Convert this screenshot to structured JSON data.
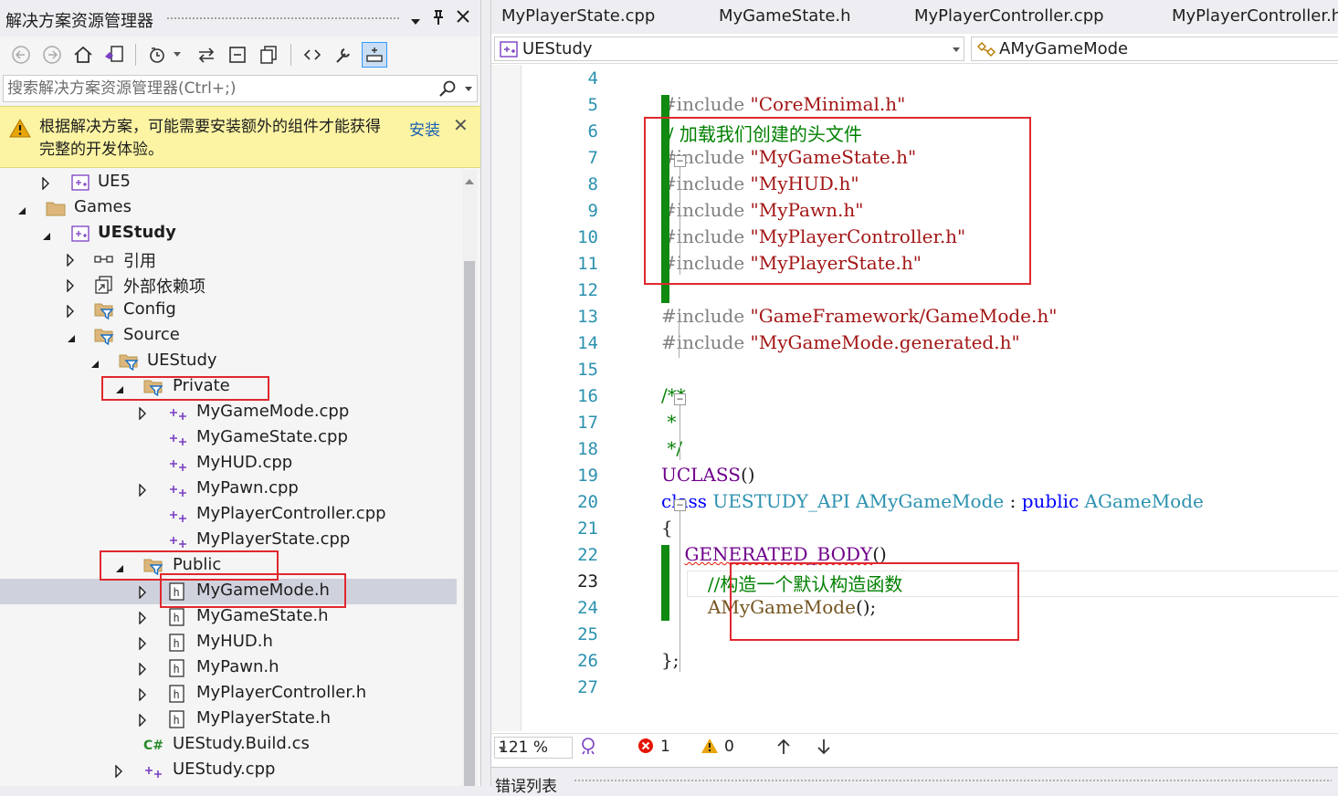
{
  "solution_explorer": {
    "title": "解决方案资源管理器",
    "search_placeholder": "搜索解决方案资源管理器(Ctrl+;)",
    "infobar": {
      "message": "根据解决方案，可能需要安装额外的组件才能获得完整的开发体验。",
      "action": "安装"
    },
    "tree": [
      {
        "label": "UE5",
        "icon": "project-icon",
        "expander": "collapsed"
      },
      {
        "label": "Games",
        "icon": "folder-icon",
        "expander": "expanded"
      },
      {
        "label": "UEStudy",
        "icon": "project-icon",
        "expander": "expanded",
        "bold": true
      },
      {
        "label": "引用",
        "icon": "references-icon",
        "expander": "collapsed"
      },
      {
        "label": "外部依赖项",
        "icon": "external-deps-icon",
        "expander": "collapsed"
      },
      {
        "label": "Config",
        "icon": "filter-folder-icon",
        "expander": "collapsed"
      },
      {
        "label": "Source",
        "icon": "filter-folder-icon",
        "expander": "expanded"
      },
      {
        "label": "UEStudy",
        "icon": "filter-folder-icon",
        "expander": "expanded"
      },
      {
        "label": "Private",
        "icon": "filter-folder-icon",
        "expander": "expanded"
      },
      {
        "label": "MyGameMode.cpp",
        "icon": "cpp-file-icon",
        "expander": "collapsed"
      },
      {
        "label": "MyGameState.cpp",
        "icon": "cpp-file-icon",
        "expander": "none"
      },
      {
        "label": "MyHUD.cpp",
        "icon": "cpp-file-icon",
        "expander": "none"
      },
      {
        "label": "MyPawn.cpp",
        "icon": "cpp-file-icon",
        "expander": "collapsed"
      },
      {
        "label": "MyPlayerController.cpp",
        "icon": "cpp-file-icon",
        "expander": "none"
      },
      {
        "label": "MyPlayerState.cpp",
        "icon": "cpp-file-icon",
        "expander": "none"
      },
      {
        "label": "Public",
        "icon": "filter-folder-icon",
        "expander": "expanded"
      },
      {
        "label": "MyGameMode.h",
        "icon": "header-file-icon",
        "expander": "collapsed",
        "selected": true
      },
      {
        "label": "MyGameState.h",
        "icon": "header-file-icon",
        "expander": "collapsed"
      },
      {
        "label": "MyHUD.h",
        "icon": "header-file-icon",
        "expander": "collapsed"
      },
      {
        "label": "MyPawn.h",
        "icon": "header-file-icon",
        "expander": "collapsed"
      },
      {
        "label": "MyPlayerController.h",
        "icon": "header-file-icon",
        "expander": "collapsed"
      },
      {
        "label": "MyPlayerState.h",
        "icon": "header-file-icon",
        "expander": "collapsed"
      },
      {
        "label": "UEStudy.Build.cs",
        "icon": "csharp-file-icon",
        "expander": "none"
      },
      {
        "label": "UEStudy.cpp",
        "icon": "cpp-file-icon",
        "expander": "collapsed"
      }
    ]
  },
  "editor": {
    "tabs": [
      "MyPlayerState.cpp",
      "MyGameState.h",
      "MyPlayerController.cpp",
      "MyPlayerController.h"
    ],
    "project_combo": "UEStudy",
    "scope_combo": "AMyGameMode",
    "current_line": 23,
    "lines": [
      {
        "n": 4,
        "tokens": []
      },
      {
        "n": 5,
        "tokens": [
          [
            "pre",
            "#include "
          ],
          [
            "str",
            "\"CoreMinimal.h\""
          ]
        ]
      },
      {
        "n": 6,
        "tokens": [
          [
            "com",
            "// 加载我们创建的头文件"
          ]
        ]
      },
      {
        "n": 7,
        "tokens": [
          [
            "pre",
            "#include "
          ],
          [
            "str",
            "\"MyGameState.h\""
          ]
        ]
      },
      {
        "n": 8,
        "tokens": [
          [
            "pre",
            "#include "
          ],
          [
            "str",
            "\"MyHUD.h\""
          ]
        ]
      },
      {
        "n": 9,
        "tokens": [
          [
            "pre",
            "#include "
          ],
          [
            "str",
            "\"MyPawn.h\""
          ]
        ]
      },
      {
        "n": 10,
        "tokens": [
          [
            "pre",
            "#include "
          ],
          [
            "str",
            "\"MyPlayerController.h\""
          ]
        ]
      },
      {
        "n": 11,
        "tokens": [
          [
            "pre",
            "#include "
          ],
          [
            "str",
            "\"MyPlayerState.h\""
          ]
        ]
      },
      {
        "n": 12,
        "tokens": []
      },
      {
        "n": 13,
        "tokens": [
          [
            "pre",
            "#include "
          ],
          [
            "str",
            "\"GameFramework/GameMode.h\""
          ]
        ]
      },
      {
        "n": 14,
        "tokens": [
          [
            "pre",
            "#include "
          ],
          [
            "str",
            "\"MyGameMode.generated.h\""
          ]
        ]
      },
      {
        "n": 15,
        "tokens": []
      },
      {
        "n": 16,
        "tokens": [
          [
            "com",
            "/**"
          ]
        ]
      },
      {
        "n": 17,
        "tokens": [
          [
            "com",
            " *"
          ]
        ]
      },
      {
        "n": 18,
        "tokens": [
          [
            "com",
            " */"
          ]
        ]
      },
      {
        "n": 19,
        "tokens": [
          [
            "mac",
            "UCLASS"
          ],
          [
            "plain",
            "()"
          ]
        ]
      },
      {
        "n": 20,
        "tokens": [
          [
            "kw",
            "class "
          ],
          [
            "type",
            "UESTUDY_API "
          ],
          [
            "type",
            "AMyGameMode"
          ],
          [
            "plain",
            " : "
          ],
          [
            "kw",
            "public "
          ],
          [
            "type",
            "AGameMode"
          ]
        ]
      },
      {
        "n": 21,
        "tokens": [
          [
            "plain",
            "{"
          ]
        ]
      },
      {
        "n": 22,
        "tokens": [
          [
            "plain",
            "    "
          ],
          [
            "macsq",
            "GENERATED_BODY"
          ],
          [
            "plain",
            "()"
          ]
        ]
      },
      {
        "n": 23,
        "tokens": [
          [
            "plain",
            "        "
          ],
          [
            "com",
            "//构造一个默认构造函数"
          ]
        ]
      },
      {
        "n": 24,
        "tokens": [
          [
            "plain",
            "        "
          ],
          [
            "fn",
            "AMyGameMode"
          ],
          [
            "plain",
            "();"
          ]
        ]
      },
      {
        "n": 25,
        "tokens": []
      },
      {
        "n": 26,
        "tokens": [
          [
            "plain",
            "};"
          ]
        ]
      },
      {
        "n": 27,
        "tokens": []
      }
    ],
    "status": {
      "zoom": "121 %",
      "errors": "1",
      "warnings": "0"
    },
    "bottom_panel_title": "错误列表"
  },
  "colors": {
    "highlight_box": "#e0282e",
    "change_bar": "#108a10",
    "selection": "#cfd2dd"
  }
}
